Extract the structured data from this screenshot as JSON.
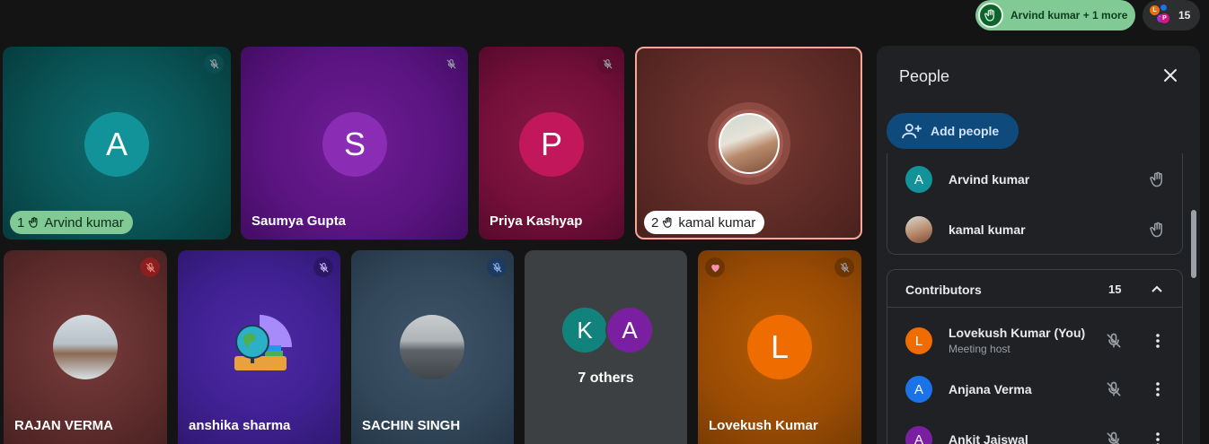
{
  "top": {
    "raised_hands_label": "Arvind kumar + 1 more",
    "participant_avatars": [
      "L",
      "S",
      "P"
    ],
    "participant_count": "15"
  },
  "tiles": [
    {
      "name": "Arvind kumar",
      "initial": "A",
      "hand_order": "1"
    },
    {
      "name": "Saumya Gupta",
      "initial": "S"
    },
    {
      "name": "Priya Kashyap",
      "initial": "P"
    },
    {
      "name": "kamal kumar",
      "hand_order": "2"
    },
    {
      "name": "RAJAN VERMA"
    },
    {
      "name": "anshika sharma"
    },
    {
      "name": "SACHIN SINGH"
    },
    {
      "name": "7 others",
      "initials": [
        "K",
        "A"
      ]
    },
    {
      "name": "Lovekush Kumar",
      "initial": "L"
    }
  ],
  "panel": {
    "title": "People",
    "add_people_label": "Add people",
    "raised_hands": [
      {
        "name": "Arvind kumar",
        "initial": "A"
      },
      {
        "name": "kamal kumar"
      }
    ],
    "contributors": {
      "label": "Contributors",
      "count": "15",
      "rows": [
        {
          "name": "Lovekush Kumar (You)",
          "sub": "Meeting host",
          "initial": "L"
        },
        {
          "name": "Anjana Verma",
          "initial": "A"
        },
        {
          "name": "Ankit Jaiswal",
          "initial": "A"
        }
      ]
    }
  },
  "colors": {
    "hand_pill": "#81c995",
    "add_button": "#0e4a7c",
    "speaking_border": "#f7a89b"
  }
}
